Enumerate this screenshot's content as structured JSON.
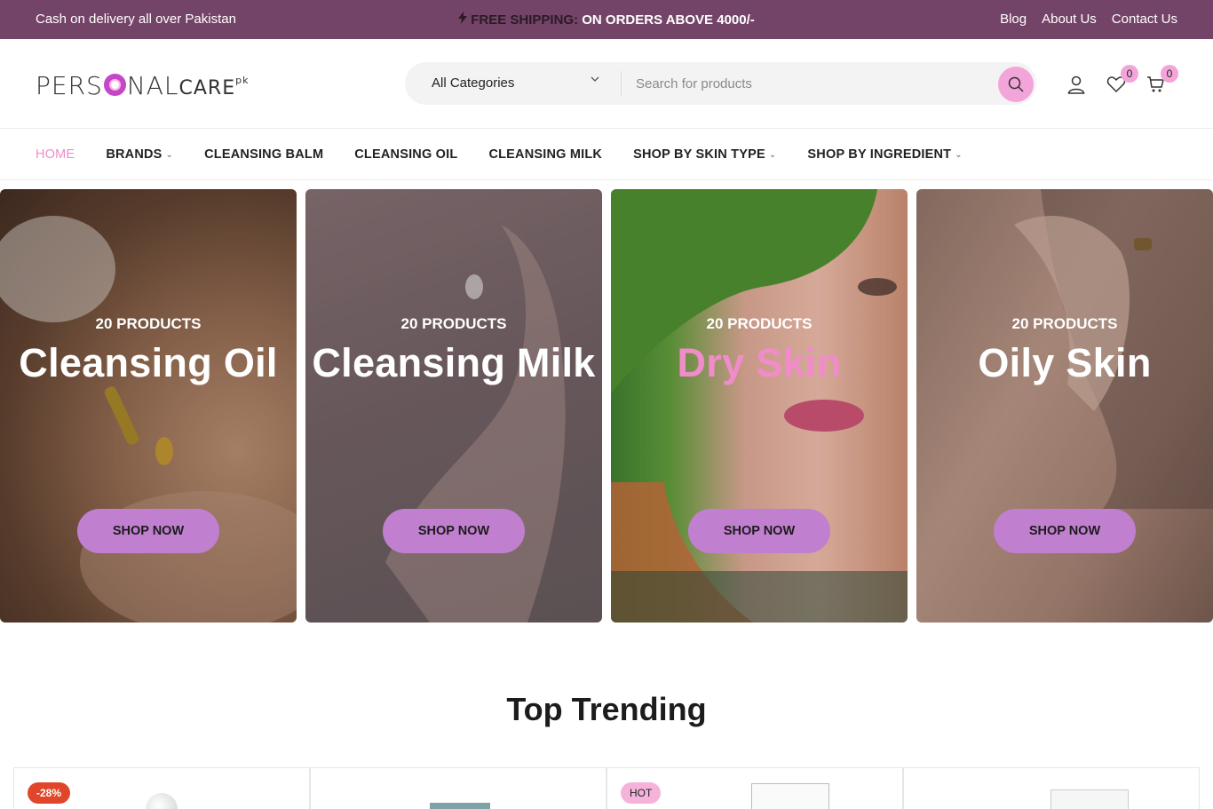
{
  "topbar": {
    "left_text": "Cash on delivery all over Pakistan",
    "shipping_label": "FREE SHIPPING:",
    "shipping_text": " ON ORDERS ABOVE 4000/-",
    "links": [
      "Blog",
      "About Us",
      "Contact Us"
    ],
    "bg_color": "#744468"
  },
  "header": {
    "logo": {
      "part1": "PERS",
      "part2": "NAL",
      "part3": "CARE",
      "suffix": "pk"
    },
    "search": {
      "category": "All Categories",
      "placeholder": "Search for products"
    },
    "wishlist_count": "0",
    "cart_count": "0"
  },
  "nav": {
    "items": [
      {
        "label": "HOME",
        "active": true,
        "dropdown": false
      },
      {
        "label": "BRANDS",
        "active": false,
        "dropdown": true
      },
      {
        "label": "CLEANSING BALM",
        "active": false,
        "dropdown": false
      },
      {
        "label": "CLEANSING OIL",
        "active": false,
        "dropdown": false
      },
      {
        "label": "CLEANSING MILK",
        "active": false,
        "dropdown": false
      },
      {
        "label": "SHOP BY SKIN TYPE",
        "active": false,
        "dropdown": true
      },
      {
        "label": "SHOP BY INGREDIENT",
        "active": false,
        "dropdown": true
      }
    ]
  },
  "banners": [
    {
      "count": "20 PRODUCTS",
      "title": "Cleansing Oil",
      "button": "SHOP NOW",
      "title_color": "#ffffff"
    },
    {
      "count": "20 PRODUCTS",
      "title": "Cleansing Milk",
      "button": "SHOP NOW",
      "title_color": "#ffffff"
    },
    {
      "count": "20 PRODUCTS",
      "title": "Dry Skin",
      "button": "SHOP NOW",
      "title_color": "#f08cc9"
    },
    {
      "count": "20 PRODUCTS",
      "title": "Oily Skin",
      "button": "SHOP NOW",
      "title_color": "#ffffff"
    }
  ],
  "trending": {
    "title": "Top Trending",
    "cards": [
      {
        "tag": "-28%",
        "tag_type": "sale"
      },
      {
        "tag": "",
        "tag_type": ""
      },
      {
        "tag": "HOT",
        "tag_type": "hot"
      },
      {
        "tag": "",
        "tag_type": ""
      }
    ]
  },
  "colors": {
    "accent_pink": "#f3a4d8",
    "button_purple": "#c17fd0",
    "sale_red": "#e0472a"
  }
}
